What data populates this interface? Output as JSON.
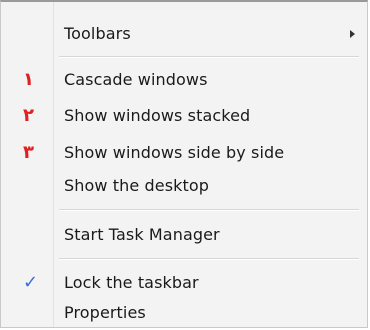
{
  "menu": {
    "items": [
      {
        "label": "Toolbars",
        "submenu": true
      },
      {
        "label": "Cascade windows",
        "marker": "۱"
      },
      {
        "label": "Show windows stacked",
        "marker": "۲"
      },
      {
        "label": "Show windows side by side",
        "marker": "۳"
      },
      {
        "label": "Show the desktop"
      },
      {
        "label": "Start Task Manager"
      },
      {
        "label": "Lock the taskbar",
        "checked": true,
        "check_glyph": "✓"
      },
      {
        "label": "Properties"
      }
    ]
  },
  "colors": {
    "marker": "#e02020",
    "check": "#3a6fd8"
  },
  "icons": {
    "submenu": "chevron-right-icon",
    "checked": "checkmark-icon"
  }
}
